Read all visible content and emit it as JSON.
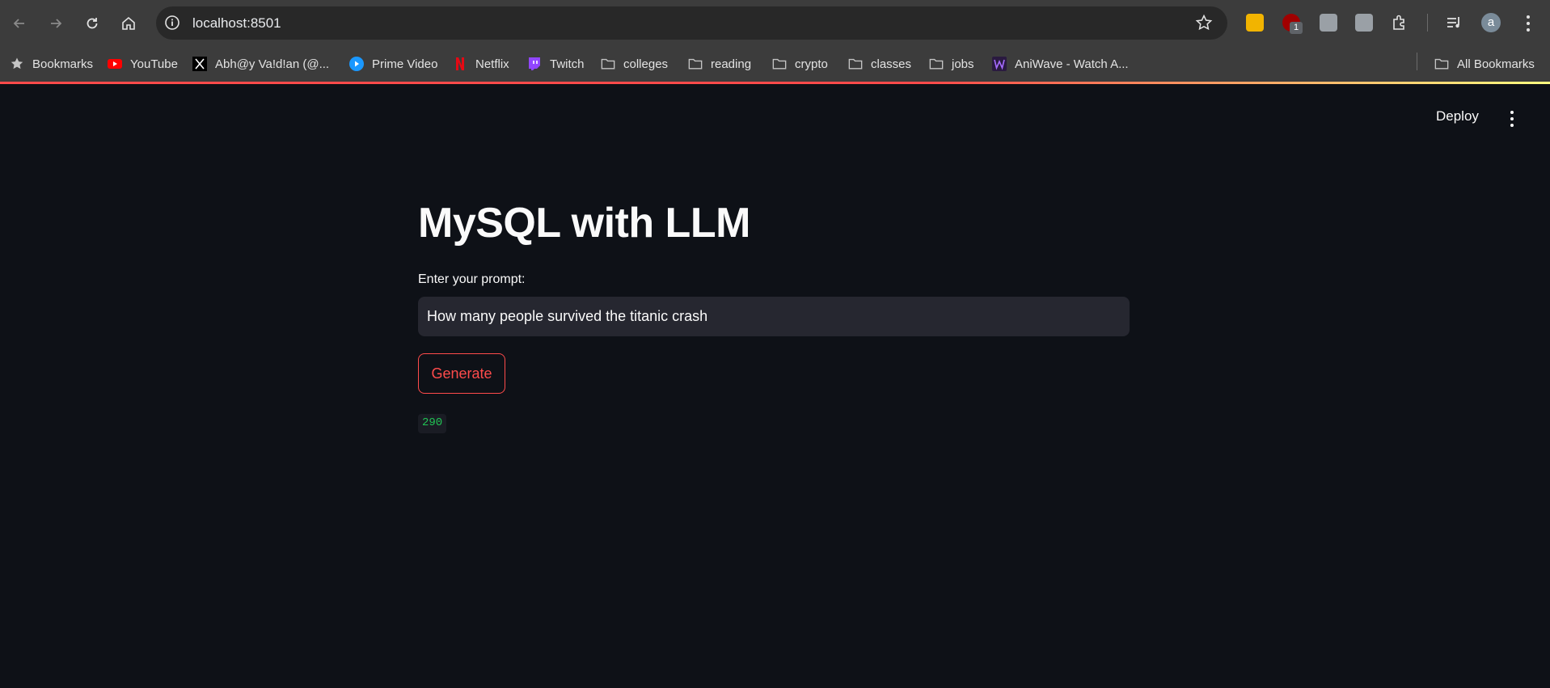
{
  "browser": {
    "url": "localhost:8501",
    "extension_badge": "1",
    "profile_initial": "a",
    "bookmarks": [
      {
        "label": "Bookmarks",
        "icon": "star-icon"
      },
      {
        "label": "YouTube",
        "icon": "youtube-icon"
      },
      {
        "label": "Abh@y Va!d!an (@...",
        "icon": "x-icon"
      },
      {
        "label": "Prime Video",
        "icon": "prime-video-icon"
      },
      {
        "label": "Netflix",
        "icon": "netflix-icon"
      },
      {
        "label": "Twitch",
        "icon": "twitch-icon"
      },
      {
        "label": "colleges",
        "icon": "folder-icon"
      },
      {
        "label": "reading",
        "icon": "folder-icon"
      },
      {
        "label": "crypto",
        "icon": "folder-icon"
      },
      {
        "label": "classes",
        "icon": "folder-icon"
      },
      {
        "label": "jobs",
        "icon": "folder-icon"
      },
      {
        "label": "AniWave - Watch A...",
        "icon": "aniwave-icon"
      }
    ],
    "all_bookmarks": "All Bookmarks"
  },
  "app": {
    "deploy_label": "Deploy",
    "title": "MySQL with LLM",
    "prompt_label": "Enter your prompt:",
    "prompt_value": "How many people survived the titanic crash",
    "generate_label": "Generate",
    "result": "290"
  },
  "colors": {
    "background": "#0e1117",
    "accent": "#ff4b4b",
    "result_text": "#21c354",
    "input_bg": "#262730"
  }
}
